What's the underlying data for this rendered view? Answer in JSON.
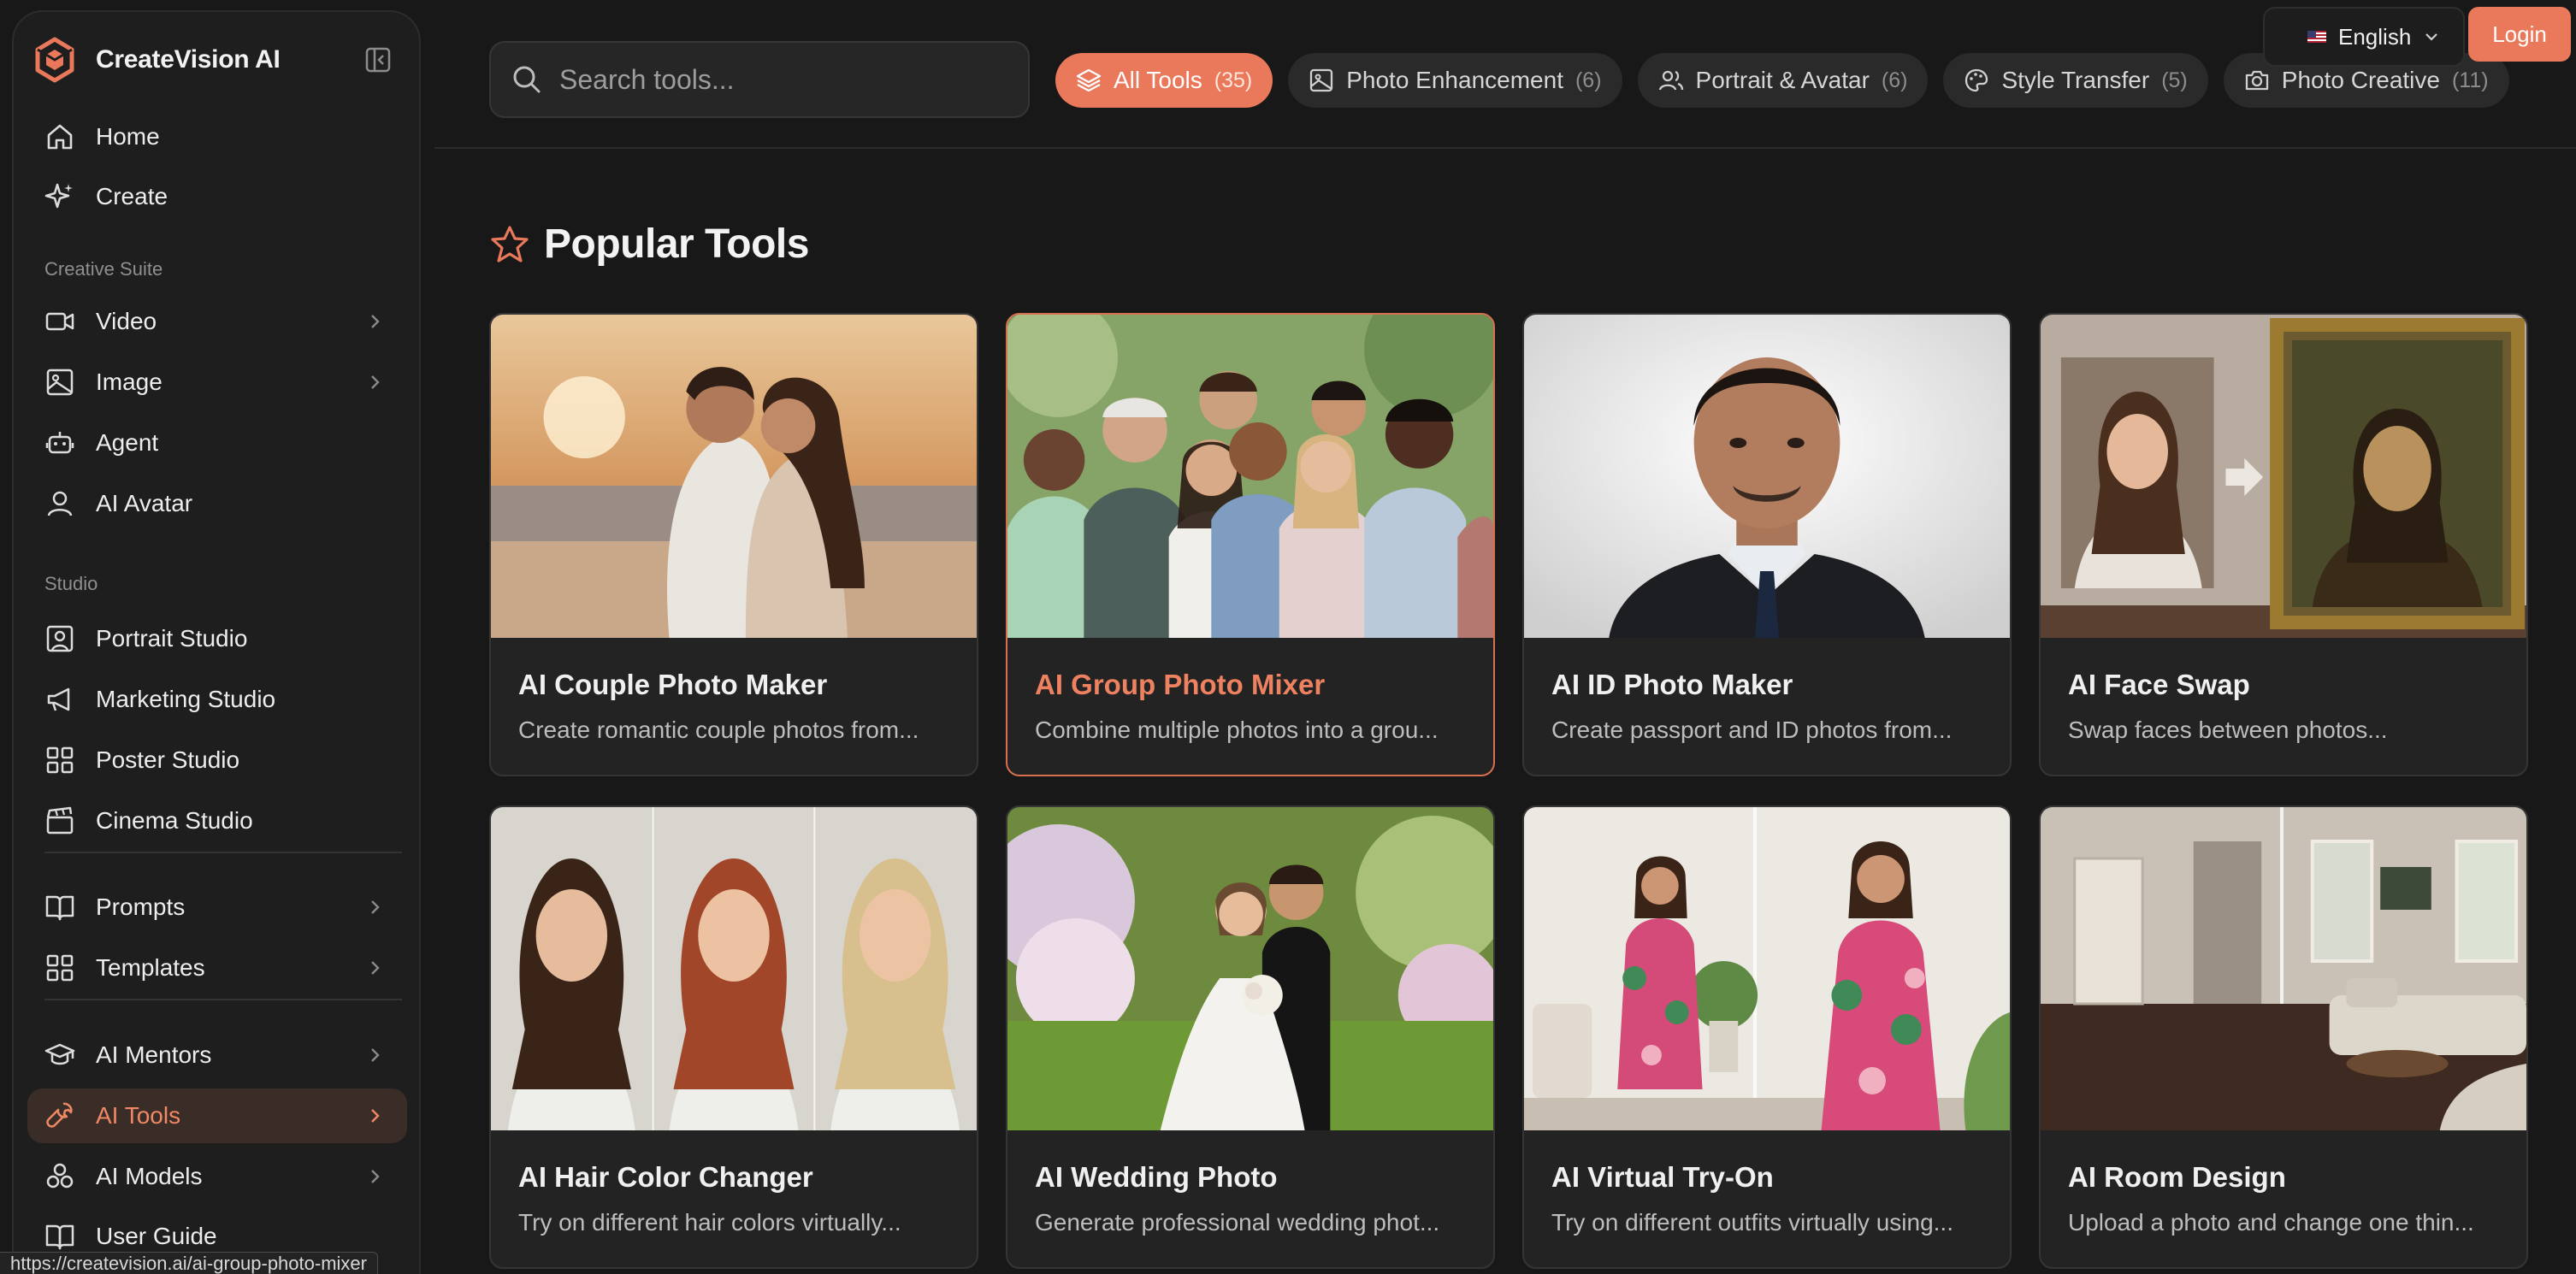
{
  "brand": {
    "name": "CreateVision AI"
  },
  "sidebar": {
    "primary": [
      {
        "label": "Home",
        "icon": "home-icon"
      },
      {
        "label": "Create",
        "icon": "sparkle-icon"
      }
    ],
    "creative_suite_label": "Creative Suite",
    "creative_suite": [
      {
        "label": "Video",
        "icon": "video-icon"
      },
      {
        "label": "Image",
        "icon": "image-icon"
      },
      {
        "label": "Agent",
        "icon": "robot-icon"
      },
      {
        "label": "AI Avatar",
        "icon": "user-icon"
      }
    ],
    "studio_label": "Studio",
    "studio": [
      {
        "label": "Portrait Studio",
        "icon": "portrait-icon"
      },
      {
        "label": "Marketing Studio",
        "icon": "megaphone-icon"
      },
      {
        "label": "Poster Studio",
        "icon": "grid-icon"
      },
      {
        "label": "Cinema Studio",
        "icon": "clapperboard-icon"
      }
    ],
    "resources": [
      {
        "label": "Prompts",
        "icon": "book-icon"
      },
      {
        "label": "Templates",
        "icon": "grid-icon"
      }
    ],
    "learn": [
      {
        "label": "AI Mentors",
        "icon": "graduation-cap-icon"
      },
      {
        "label": "AI Tools",
        "icon": "wrench-icon"
      },
      {
        "label": "AI Models",
        "icon": "models-icon"
      },
      {
        "label": "User Guide",
        "icon": "book-open-icon"
      }
    ]
  },
  "status_bar": {
    "url": "https://createvision.ai/ai-group-photo-mixer"
  },
  "search": {
    "placeholder": "Search tools..."
  },
  "filters": [
    {
      "label": "All Tools",
      "count": "(35)",
      "active": true
    },
    {
      "label": "Photo Enhancement",
      "count": "(6)"
    },
    {
      "label": "Portrait & Avatar",
      "count": "(6)"
    },
    {
      "label": "Style Transfer",
      "count": "(5)"
    },
    {
      "label": "Photo Creative",
      "count": "(11)"
    }
  ],
  "header": {
    "language": "English",
    "login": "Login"
  },
  "section": {
    "title": "Popular Tools"
  },
  "tools": [
    {
      "title": "AI Couple Photo Maker",
      "desc": "Create romantic couple photos from..."
    },
    {
      "title": "AI Group Photo Mixer",
      "desc": "Combine multiple photos into a grou..."
    },
    {
      "title": "AI ID Photo Maker",
      "desc": "Create passport and ID photos from..."
    },
    {
      "title": "AI Face Swap",
      "desc": "Swap faces between photos..."
    },
    {
      "title": "AI Hair Color Changer",
      "desc": "Try on different hair colors virtually..."
    },
    {
      "title": "AI Wedding Photo",
      "desc": "Generate professional wedding phot..."
    },
    {
      "title": "AI Virtual Try-On",
      "desc": "Try on different outfits virtually using..."
    },
    {
      "title": "AI Room Design",
      "desc": "Upload a photo and change one thin..."
    }
  ],
  "colors": {
    "accent": "#e9795a",
    "background": "#181818",
    "sidebar": "#1e1e1e",
    "card": "#232323"
  }
}
